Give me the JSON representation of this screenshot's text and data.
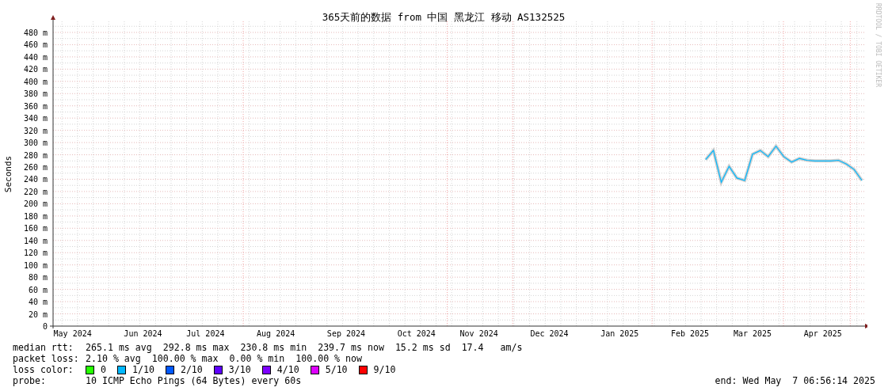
{
  "chart": {
    "chart_data": {
      "type": "line",
      "title": "365天前的数据 from 中国 黑龙江 移动 AS132525",
      "ylabel": "Seconds",
      "grid": true,
      "categories": [
        null,
        null,
        "May 2024",
        null,
        null,
        null,
        null,
        null,
        null,
        null,
        null,
        "Jun 2024",
        null,
        null,
        null,
        null,
        null,
        null,
        null,
        "Jul 2024",
        null,
        null,
        null,
        null,
        null,
        null,
        null,
        null,
        "Aug 2024",
        null,
        null,
        null,
        null,
        null,
        null,
        null,
        null,
        "Sep 2024",
        null,
        null,
        null,
        null,
        null,
        null,
        null,
        null,
        "Oct 2024",
        null,
        null,
        null,
        null,
        null,
        null,
        null,
        "Nov 2024",
        null,
        null,
        null,
        null,
        null,
        null,
        null,
        null,
        "Dec 2024",
        null,
        null,
        null,
        null,
        null,
        null,
        null,
        null,
        "Jan 2025",
        null,
        null,
        null,
        null,
        null,
        null,
        null,
        null,
        "Feb 2025",
        null,
        null,
        null,
        null,
        null,
        null,
        null,
        "Mar 2025",
        null,
        null,
        null,
        null,
        null,
        null,
        null,
        null,
        "Apr 2025",
        null,
        null,
        null,
        null,
        null
      ],
      "ylim": [
        0,
        480
      ],
      "yticks": [
        {
          "value": 0,
          "label": "0"
        },
        {
          "value": 20,
          "label": "20 m"
        },
        {
          "value": 40,
          "label": "40 m"
        },
        {
          "value": 60,
          "label": "60 m"
        },
        {
          "value": 80,
          "label": "80 m"
        },
        {
          "value": 100,
          "label": "100 m"
        },
        {
          "value": 120,
          "label": "120 m"
        },
        {
          "value": 140,
          "label": "140 m"
        },
        {
          "value": 160,
          "label": "160 m"
        },
        {
          "value": 180,
          "label": "180 m"
        },
        {
          "value": 200,
          "label": "200 m"
        },
        {
          "value": 220,
          "label": "220 m"
        },
        {
          "value": 240,
          "label": "240 m"
        },
        {
          "value": 260,
          "label": "260 m"
        },
        {
          "value": 280,
          "label": "280 m"
        },
        {
          "value": 300,
          "label": "300 m"
        },
        {
          "value": 320,
          "label": "320 m"
        },
        {
          "value": 340,
          "label": "340 m"
        },
        {
          "value": 360,
          "label": "360 m"
        },
        {
          "value": 380,
          "label": "380 m"
        },
        {
          "value": 400,
          "label": "400 m"
        },
        {
          "value": 420,
          "label": "420 m"
        },
        {
          "value": 440,
          "label": "440 m"
        },
        {
          "value": 460,
          "label": "460 m"
        },
        {
          "value": 480,
          "label": "480 m"
        }
      ],
      "series": [
        {
          "color": "#00b8ff",
          "values": [
            null,
            null,
            null,
            null,
            null,
            null,
            null,
            null,
            null,
            null,
            null,
            null,
            null,
            null,
            null,
            null,
            null,
            null,
            null,
            null,
            null,
            null,
            null,
            null,
            null,
            null,
            null,
            null,
            null,
            null,
            null,
            null,
            null,
            null,
            null,
            null,
            null,
            null,
            null,
            null,
            null,
            null,
            null,
            null,
            null,
            null,
            null,
            null,
            null,
            null,
            null,
            null,
            null,
            null,
            null,
            null,
            null,
            null,
            null,
            null,
            null,
            null,
            null,
            null,
            null,
            null,
            null,
            null,
            null,
            null,
            null,
            null,
            null,
            null,
            null,
            null,
            null,
            null,
            null,
            null,
            null,
            null,
            null,
            272,
            287,
            235,
            261,
            242,
            238,
            281,
            287,
            277,
            294,
            277,
            268,
            274,
            271,
            270,
            270,
            270,
            271,
            265,
            256,
            238
          ]
        }
      ]
    }
  },
  "side_note": "RRDTOOL / TOBI OETIKER",
  "legend": [
    {
      "kind": "stats",
      "label": "median rtt:",
      "text": "265.1 ms avg  292.8 ms max  230.8 ms min  239.7 ms now  15.2 ms sd  17.4   am/s"
    },
    {
      "kind": "stats",
      "label": "packet loss:",
      "text": "2.10 % avg  100.00 % max  0.00 % min  100.00 % now"
    },
    {
      "kind": "colors",
      "label": "loss color:",
      "items": [
        {
          "label": "0",
          "color": "#26ff00"
        },
        {
          "label": "1/10",
          "color": "#00b8ff"
        },
        {
          "label": "2/10",
          "color": "#0059ff"
        },
        {
          "label": "3/10",
          "color": "#5e00ff"
        },
        {
          "label": "4/10",
          "color": "#7e00ff"
        },
        {
          "label": "5/10",
          "color": "#dd00ff"
        },
        {
          "label": "9/10",
          "color": "#ff0000"
        }
      ]
    },
    {
      "kind": "probe",
      "label": "probe:",
      "text": "10 ICMP Echo Pings (64 Bytes) every 60s",
      "end": "end: Wed May  7 06:56:14 2025"
    }
  ]
}
